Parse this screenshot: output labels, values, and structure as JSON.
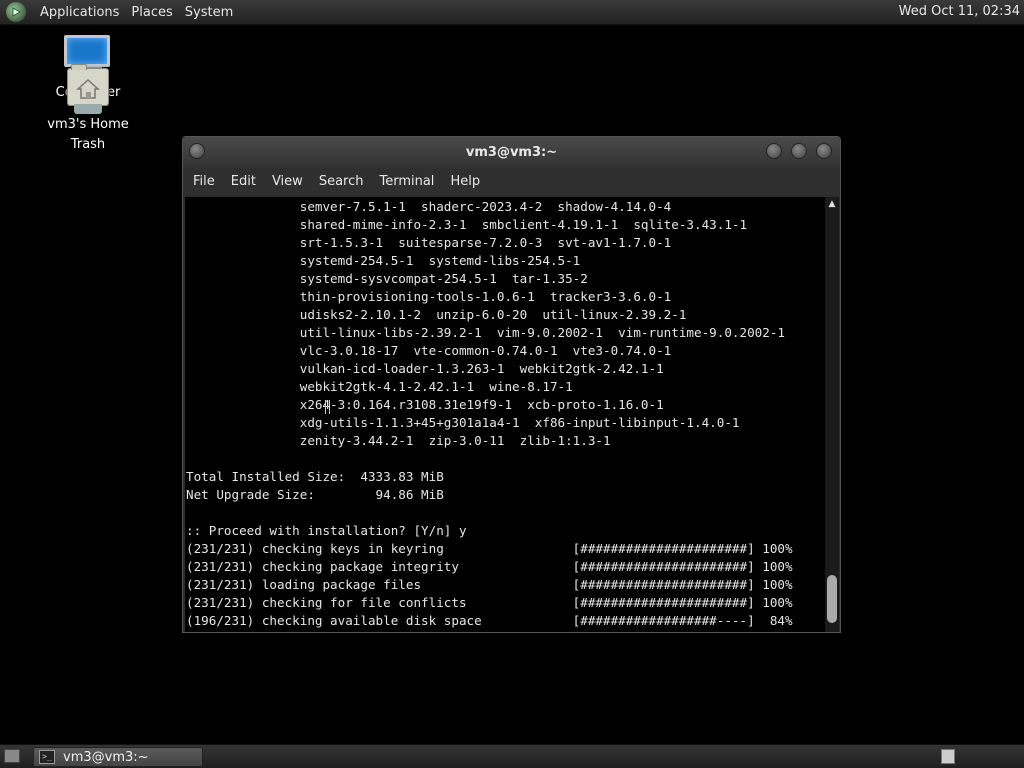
{
  "top_panel": {
    "menus": [
      "Applications",
      "Places",
      "System"
    ],
    "clock": "Wed Oct 11, 02:34"
  },
  "desktop": {
    "icons": {
      "computer": "Computer",
      "home": "vm3's Home",
      "trash": "Trash"
    }
  },
  "window": {
    "title": "vm3@vm3:~",
    "menus": [
      "File",
      "Edit",
      "View",
      "Search",
      "Terminal",
      "Help"
    ],
    "terminal_lines": [
      "               semver-7.5.1-1  shaderc-2023.4-2  shadow-4.14.0-4",
      "               shared-mime-info-2.3-1  smbclient-4.19.1-1  sqlite-3.43.1-1",
      "               srt-1.5.3-1  suitesparse-7.2.0-3  svt-av1-1.7.0-1",
      "               systemd-254.5-1  systemd-libs-254.5-1",
      "               systemd-sysvcompat-254.5-1  tar-1.35-2",
      "               thin-provisioning-tools-1.0.6-1  tracker3-3.6.0-1",
      "               udisks2-2.10.1-2  unzip-6.0-20  util-linux-2.39.2-1",
      "               util-linux-libs-2.39.2-1  vim-9.0.2002-1  vim-runtime-9.0.2002-1",
      "               vlc-3.0.18-17  vte-common-0.74.0-1  vte3-0.74.0-1",
      "               vulkan-icd-loader-1.3.263-1  webkit2gtk-2.42.1-1",
      "               webkit2gtk-4.1-2.42.1-1  wine-8.17-1",
      "               x264-3:0.164.r3108.31e19f9-1  xcb-proto-1.16.0-1",
      "               xdg-utils-1.1.3+45+g301a1a4-1  xf86-input-libinput-1.4.0-1",
      "               zenity-3.44.2-1  zip-3.0-11  zlib-1:1.3-1",
      "",
      "Total Installed Size:  4333.83 MiB",
      "Net Upgrade Size:        94.86 MiB",
      "",
      ":: Proceed with installation? [Y/n] y",
      "(231/231) checking keys in keyring                 [######################] 100%",
      "(231/231) checking package integrity               [######################] 100%",
      "(231/231) loading package files                    [######################] 100%",
      "(231/231) checking for file conflicts              [######################] 100%",
      "(196/231) checking available disk space            [##################----]  84%"
    ]
  },
  "taskbar": {
    "task_label": "vm3@vm3:~"
  }
}
